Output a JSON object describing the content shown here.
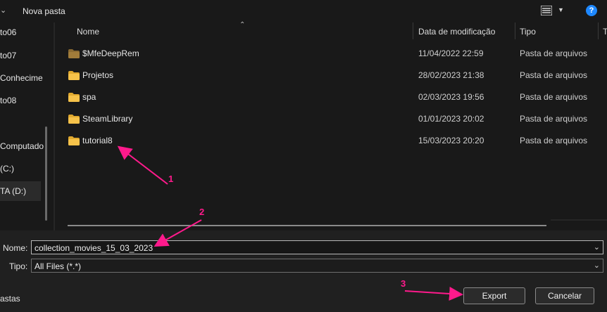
{
  "toolbar": {
    "new_folder_label": "Nova pasta",
    "view_icon": "view-options-icon",
    "help_icon": "help-icon",
    "help_glyph": "?"
  },
  "nav": {
    "items": [
      {
        "label": "to06"
      },
      {
        "label": "to07"
      },
      {
        "label": "Conhecime"
      },
      {
        "label": "to08"
      },
      {
        "label": "Computado"
      },
      {
        "label": "(C:)"
      },
      {
        "label": "TA (D:)"
      }
    ]
  },
  "columns": {
    "name": "Nome",
    "date": "Data de modificação",
    "type": "Tipo",
    "extra": "T"
  },
  "files": [
    {
      "name": "$MfeDeepRem",
      "date": "11/04/2022 22:59",
      "type": "Pasta de arquivos",
      "icon": "folder-icon-dim"
    },
    {
      "name": "Projetos",
      "date": "28/02/2023 21:38",
      "type": "Pasta de arquivos",
      "icon": "folder-icon"
    },
    {
      "name": "spa",
      "date": "02/03/2023 19:56",
      "type": "Pasta de arquivos",
      "icon": "folder-icon"
    },
    {
      "name": "SteamLibrary",
      "date": "01/01/2023 20:02",
      "type": "Pasta de arquivos",
      "icon": "folder-icon"
    },
    {
      "name": "tutorial8",
      "date": "15/03/2023 20:20",
      "type": "Pasta de arquivos",
      "icon": "folder-icon"
    }
  ],
  "save": {
    "name_label": "Nome:",
    "name_value": "collection_movies_15_03_2023",
    "type_label": "Tipo:",
    "type_value": "All Files (*.*)",
    "hide_folders_label": "astas",
    "export_label": "Export",
    "cancel_label": "Cancelar"
  },
  "annotations": {
    "color": "#ff1a8c",
    "labels": [
      "1",
      "2",
      "3"
    ]
  },
  "colors": {
    "background": "#191919",
    "panel": "#202020",
    "folder": "#f6c24a",
    "accent": "#1e88ff"
  }
}
